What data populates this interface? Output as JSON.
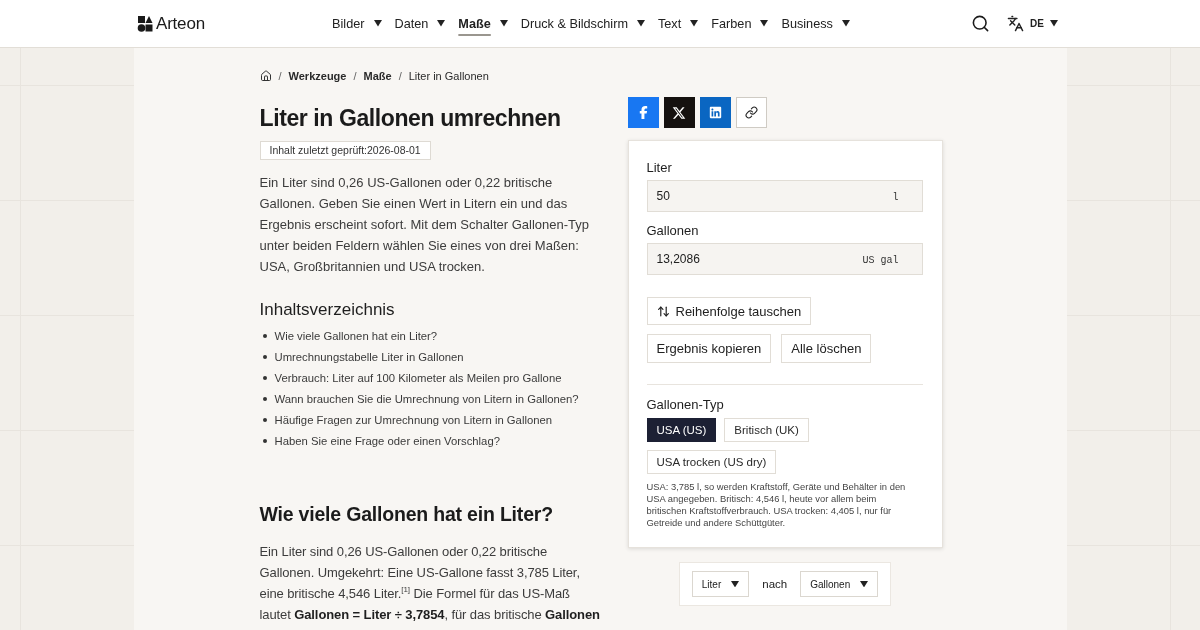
{
  "header": {
    "logo": "Arteon",
    "nav": [
      {
        "label": "Bilder",
        "selected": false
      },
      {
        "label": "Daten",
        "selected": false
      },
      {
        "label": "Maße",
        "selected": true
      },
      {
        "label": "Druck & Bildschirm",
        "selected": false
      },
      {
        "label": "Text",
        "selected": false
      },
      {
        "label": "Farben",
        "selected": false
      },
      {
        "label": "Business",
        "selected": false
      }
    ],
    "language": "DE"
  },
  "breadcrumb": [
    {
      "kind": "home"
    },
    {
      "kind": "separator",
      "text": "/"
    },
    {
      "kind": "link",
      "text": "Werkzeuge"
    },
    {
      "kind": "separator",
      "text": "/"
    },
    {
      "kind": "link",
      "text": "Maße"
    },
    {
      "kind": "separator",
      "text": "/"
    },
    {
      "kind": "current",
      "text": "Liter in Gallonen"
    }
  ],
  "title": "Liter in Gallonen umrechnen",
  "reviewed_badge": "Inhalt zuletzt geprüft:2026-08-01",
  "intro": "Ein Liter sind 0,26 US-Gallonen oder 0,22 britische Gallonen. Geben Sie einen Wert in Litern ein und das Ergebnis erscheint sofort. Mit dem Schalter Gallonen-Typ unter beiden Feldern wählen Sie eines von drei Maßen: USA, Großbritannien und USA trocken.",
  "toc": {
    "title": "Inhaltsverzeichnis",
    "items": [
      "Wie viele Gallonen hat ein Liter?",
      "Umrechnungstabelle Liter in Gallonen",
      "Verbrauch: Liter auf 100 Kilometer als Meilen pro Gallone",
      "Wann brauchen Sie die Umrechnung von Litern in Gallonen?",
      "Häufige Fragen zur Umrechnung von Litern in Gallonen",
      "Haben Sie eine Frage oder einen Vorschlag?"
    ]
  },
  "section": {
    "title": "Wie viele Gallonen hat ein Liter?",
    "text": "Ein Liter sind 0,26 US-Gallonen oder 0,22 britische Gallonen. Umgekehrt: Eine US-Gallone fasst 3,785 Liter, eine britische 4,546 Liter.$^{[1]}$ Die Formel für das US-Maß lautet **Gallonen = Liter ÷ 3,7854**, für das britische **Gallonen**"
  },
  "share": [
    {
      "kind": "facebook"
    },
    {
      "kind": "x"
    },
    {
      "kind": "linkedin"
    },
    {
      "kind": "link"
    }
  ],
  "converter": {
    "fields": [
      {
        "label": "Liter",
        "value": "50",
        "unit": "l"
      },
      {
        "label": "Gallonen",
        "value": "13,2086",
        "unit": "US gal"
      }
    ],
    "swap_button": "Reihenfolge tauschen",
    "actions": [
      "Ergebnis kopieren",
      "Alle löschen"
    ],
    "type_label": "Gallonen-Typ",
    "types": [
      {
        "label": "USA (US)",
        "selected": true
      },
      {
        "label": "Britisch (UK)",
        "selected": false
      },
      {
        "label": "USA trocken (US dry)",
        "selected": false
      }
    ],
    "note": "USA: 3,785 l, so werden Kraftstoff, Geräte und Behälter in den USA angegeben. Britisch: 4,546 l, heute vor allem beim britischen Kraftstoffverbrauch. USA trocken: 4,405 l, nur für Getreide und andere Schüttgüter."
  },
  "unit_picker": {
    "from": "Liter",
    "joiner": "nach",
    "to": "Gallonen"
  }
}
